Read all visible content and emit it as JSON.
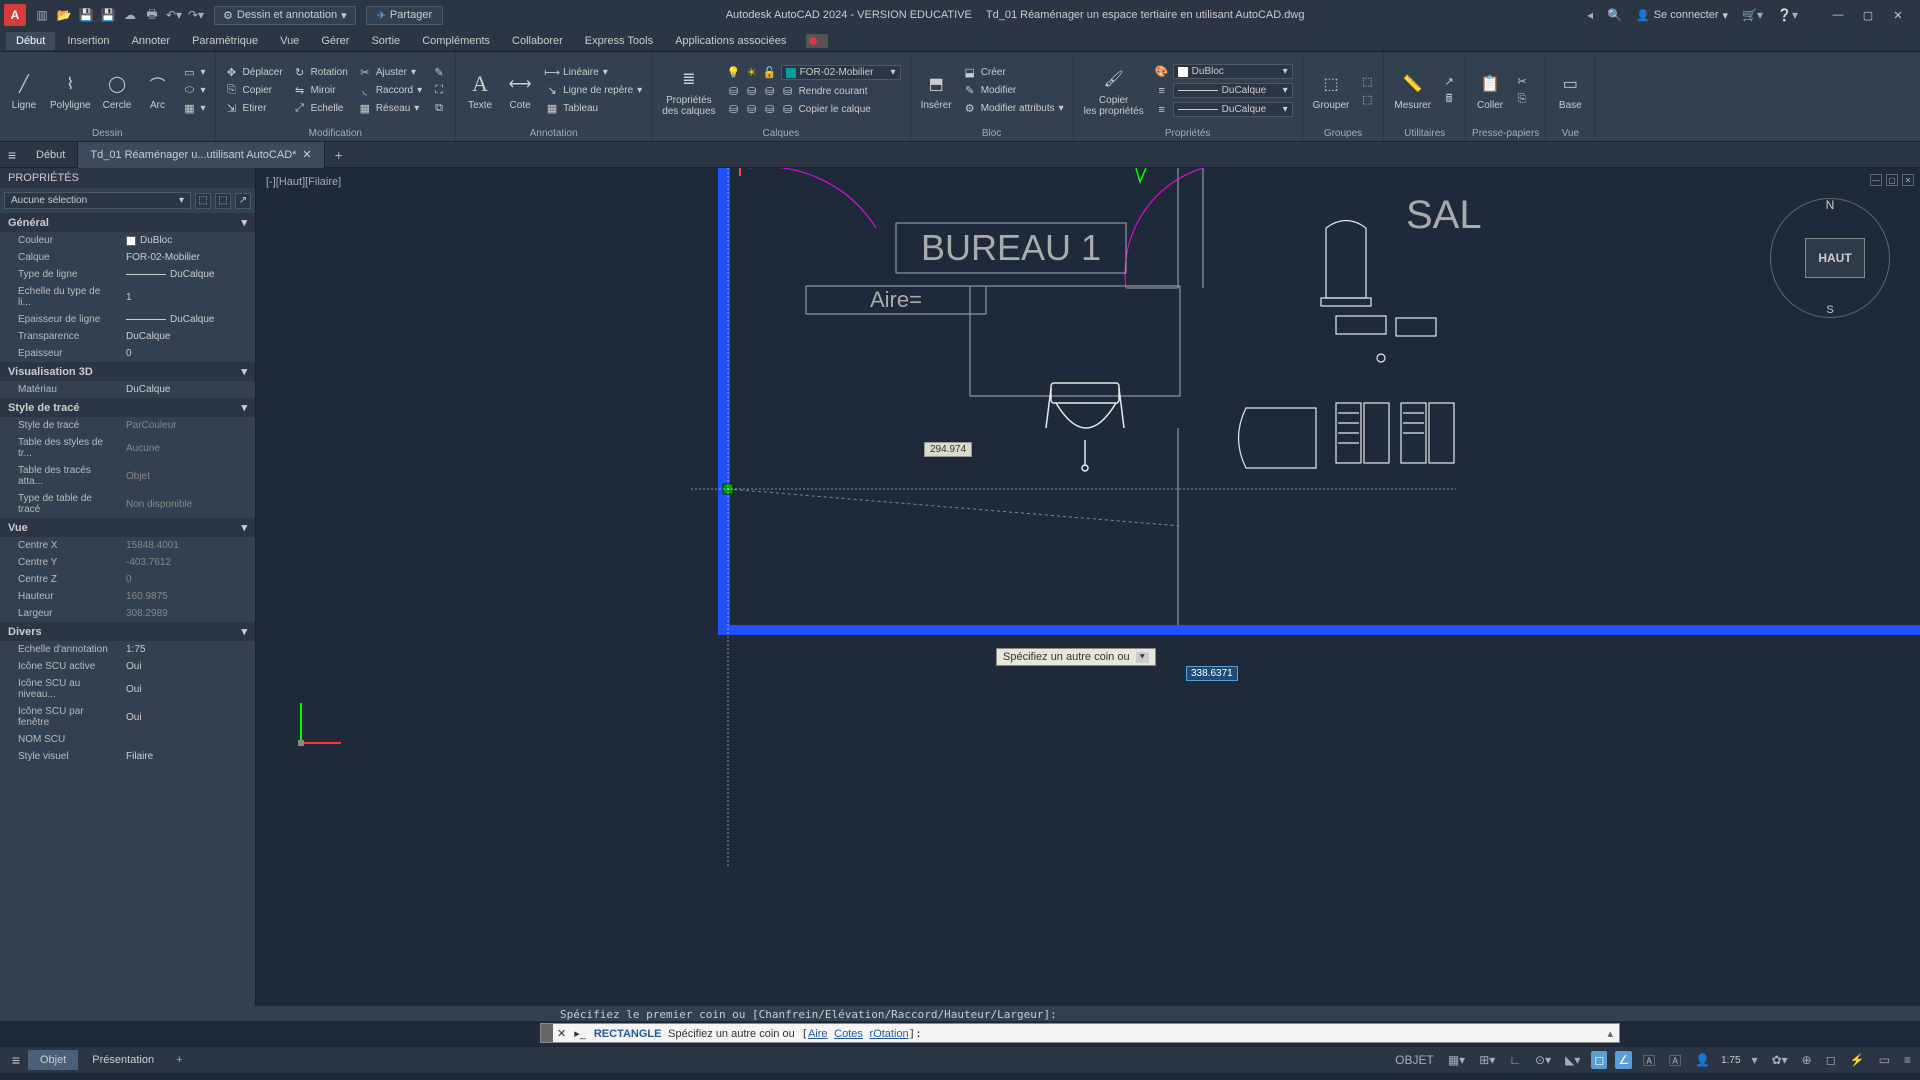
{
  "title": {
    "app": "Autodesk AutoCAD 2024 - VERSION EDUCATIVE",
    "file": "Td_01 Réaménager un espace tertiaire en utilisant AutoCAD.dwg"
  },
  "workspace": "Dessin et annotation",
  "share": "Partager",
  "signin": "Se connecter",
  "menu": [
    "Début",
    "Insertion",
    "Annoter",
    "Paramétrique",
    "Vue",
    "Gérer",
    "Sortie",
    "Compléments",
    "Collaborer",
    "Express Tools",
    "Applications associées"
  ],
  "ribbon": {
    "dessin": {
      "label": "Dessin",
      "ligne": "Ligne",
      "polyligne": "Polyligne",
      "cercle": "Cercle",
      "arc": "Arc"
    },
    "modification": {
      "label": "Modification",
      "deplacer": "Déplacer",
      "rotation": "Rotation",
      "ajuster": "Ajuster",
      "copier": "Copier",
      "miroir": "Miroir",
      "raccord": "Raccord",
      "etirer": "Etirer",
      "echelle": "Echelle",
      "reseau": "Réseau"
    },
    "annotation": {
      "label": "Annotation",
      "texte": "Texte",
      "cote": "Cote",
      "lineaire": "Linéaire",
      "repere": "Ligne de repère",
      "tableau": "Tableau"
    },
    "calques": {
      "label": "Calques",
      "prop": "Propriétés\ndes calques",
      "current": "FOR-02-Mobilier",
      "rendre": "Rendre courant",
      "geler": "Copier le calque"
    },
    "bloc": {
      "label": "Bloc",
      "inserer": "Insérer",
      "creer": "Créer",
      "modifier": "Modifier",
      "modattr": "Modifier attributs"
    },
    "proprietes": {
      "label": "Propriétés",
      "copier": "Copier\nles propriétés",
      "color": "DuBloc",
      "ltype": "DuCalque",
      "lweight": "DuCalque"
    },
    "groupes": {
      "label": "Groupes",
      "grouper": "Grouper"
    },
    "utilitaires": {
      "label": "Utilitaires",
      "mesurer": "Mesurer"
    },
    "presse": {
      "label": "Presse-papiers",
      "coller": "Coller"
    },
    "vue": {
      "label": "Vue",
      "base": "Base"
    }
  },
  "filetabs": {
    "debut": "Début",
    "file": "Td_01 Réaménager u...utilisant AutoCAD*"
  },
  "props": {
    "title": "PROPRIÉTÉS",
    "selection": "Aucune sélection",
    "general": {
      "h": "Général",
      "couleur": "Couleur",
      "couleur_v": "DuBloc",
      "calque": "Calque",
      "calque_v": "FOR-02-Mobilier",
      "typeligne": "Type de ligne",
      "typeligne_v": "DuCalque",
      "echelle": "Echelle du type de li...",
      "echelle_v": "1",
      "epaisseur": "Epaisseur de ligne",
      "epaisseur_v": "DuCalque",
      "transparence": "Transparence",
      "transparence_v": "DuCalque",
      "ep": "Epaisseur",
      "ep_v": "0"
    },
    "visu": {
      "h": "Visualisation 3D",
      "materiau": "Matériau",
      "materiau_v": "DuCalque"
    },
    "style": {
      "h": "Style de tracé",
      "st": "Style de tracé",
      "st_v": "ParCouleur",
      "tbl": "Table des styles de tr...",
      "tbl_v": "Aucune",
      "att": "Table des tracés atta...",
      "att_v": "Objet",
      "type": "Type de table de tracé",
      "type_v": "Non disponible"
    },
    "vue": {
      "h": "Vue",
      "cx": "Centre X",
      "cx_v": "15848.4001",
      "cy": "Centre Y",
      "cy_v": "-403.7612",
      "cz": "Centre Z",
      "cz_v": "0",
      "haut": "Hauteur",
      "haut_v": "160.9875",
      "larg": "Largeur",
      "larg_v": "308.2989"
    },
    "divers": {
      "h": "Divers",
      "echan": "Echelle d'annotation",
      "echan_v": "1:75",
      "scuact": "Icône SCU active",
      "scuact_v": "Oui",
      "scuniv": "Icône SCU au niveau...",
      "scuniv_v": "Oui",
      "scufen": "Icône SCU par fenêtre",
      "scufen_v": "Oui",
      "nomscu": "NOM SCU",
      "nomscu_v": "",
      "visuel": "Style visuel",
      "visuel_v": "Filaire"
    }
  },
  "canvas": {
    "viewlabel": "[-][Haut][Filaire]",
    "viewcube": "HAUT",
    "north": "N",
    "south": "S",
    "bureau": "BUREAU 1",
    "aire": "Aire=",
    "salle": "SAL",
    "coord": "294.974",
    "tooltip": "Spécifiez un autre coin ou",
    "dyninput": "338.6371"
  },
  "cmd": {
    "history": "Spécifiez le premier coin ou [Chanfrein/Elévation/Raccord/Hauteur/Largeur]:",
    "cmd": "RECTANGLE",
    "prompt": "Spécifiez un autre coin ou",
    "o1": "Aire",
    "o2": "Cotes",
    "o3": "rOtation"
  },
  "status": {
    "objet": "Objet",
    "presentation": "Présentation",
    "objet_btn": "OBJET",
    "scale": "1:75"
  }
}
